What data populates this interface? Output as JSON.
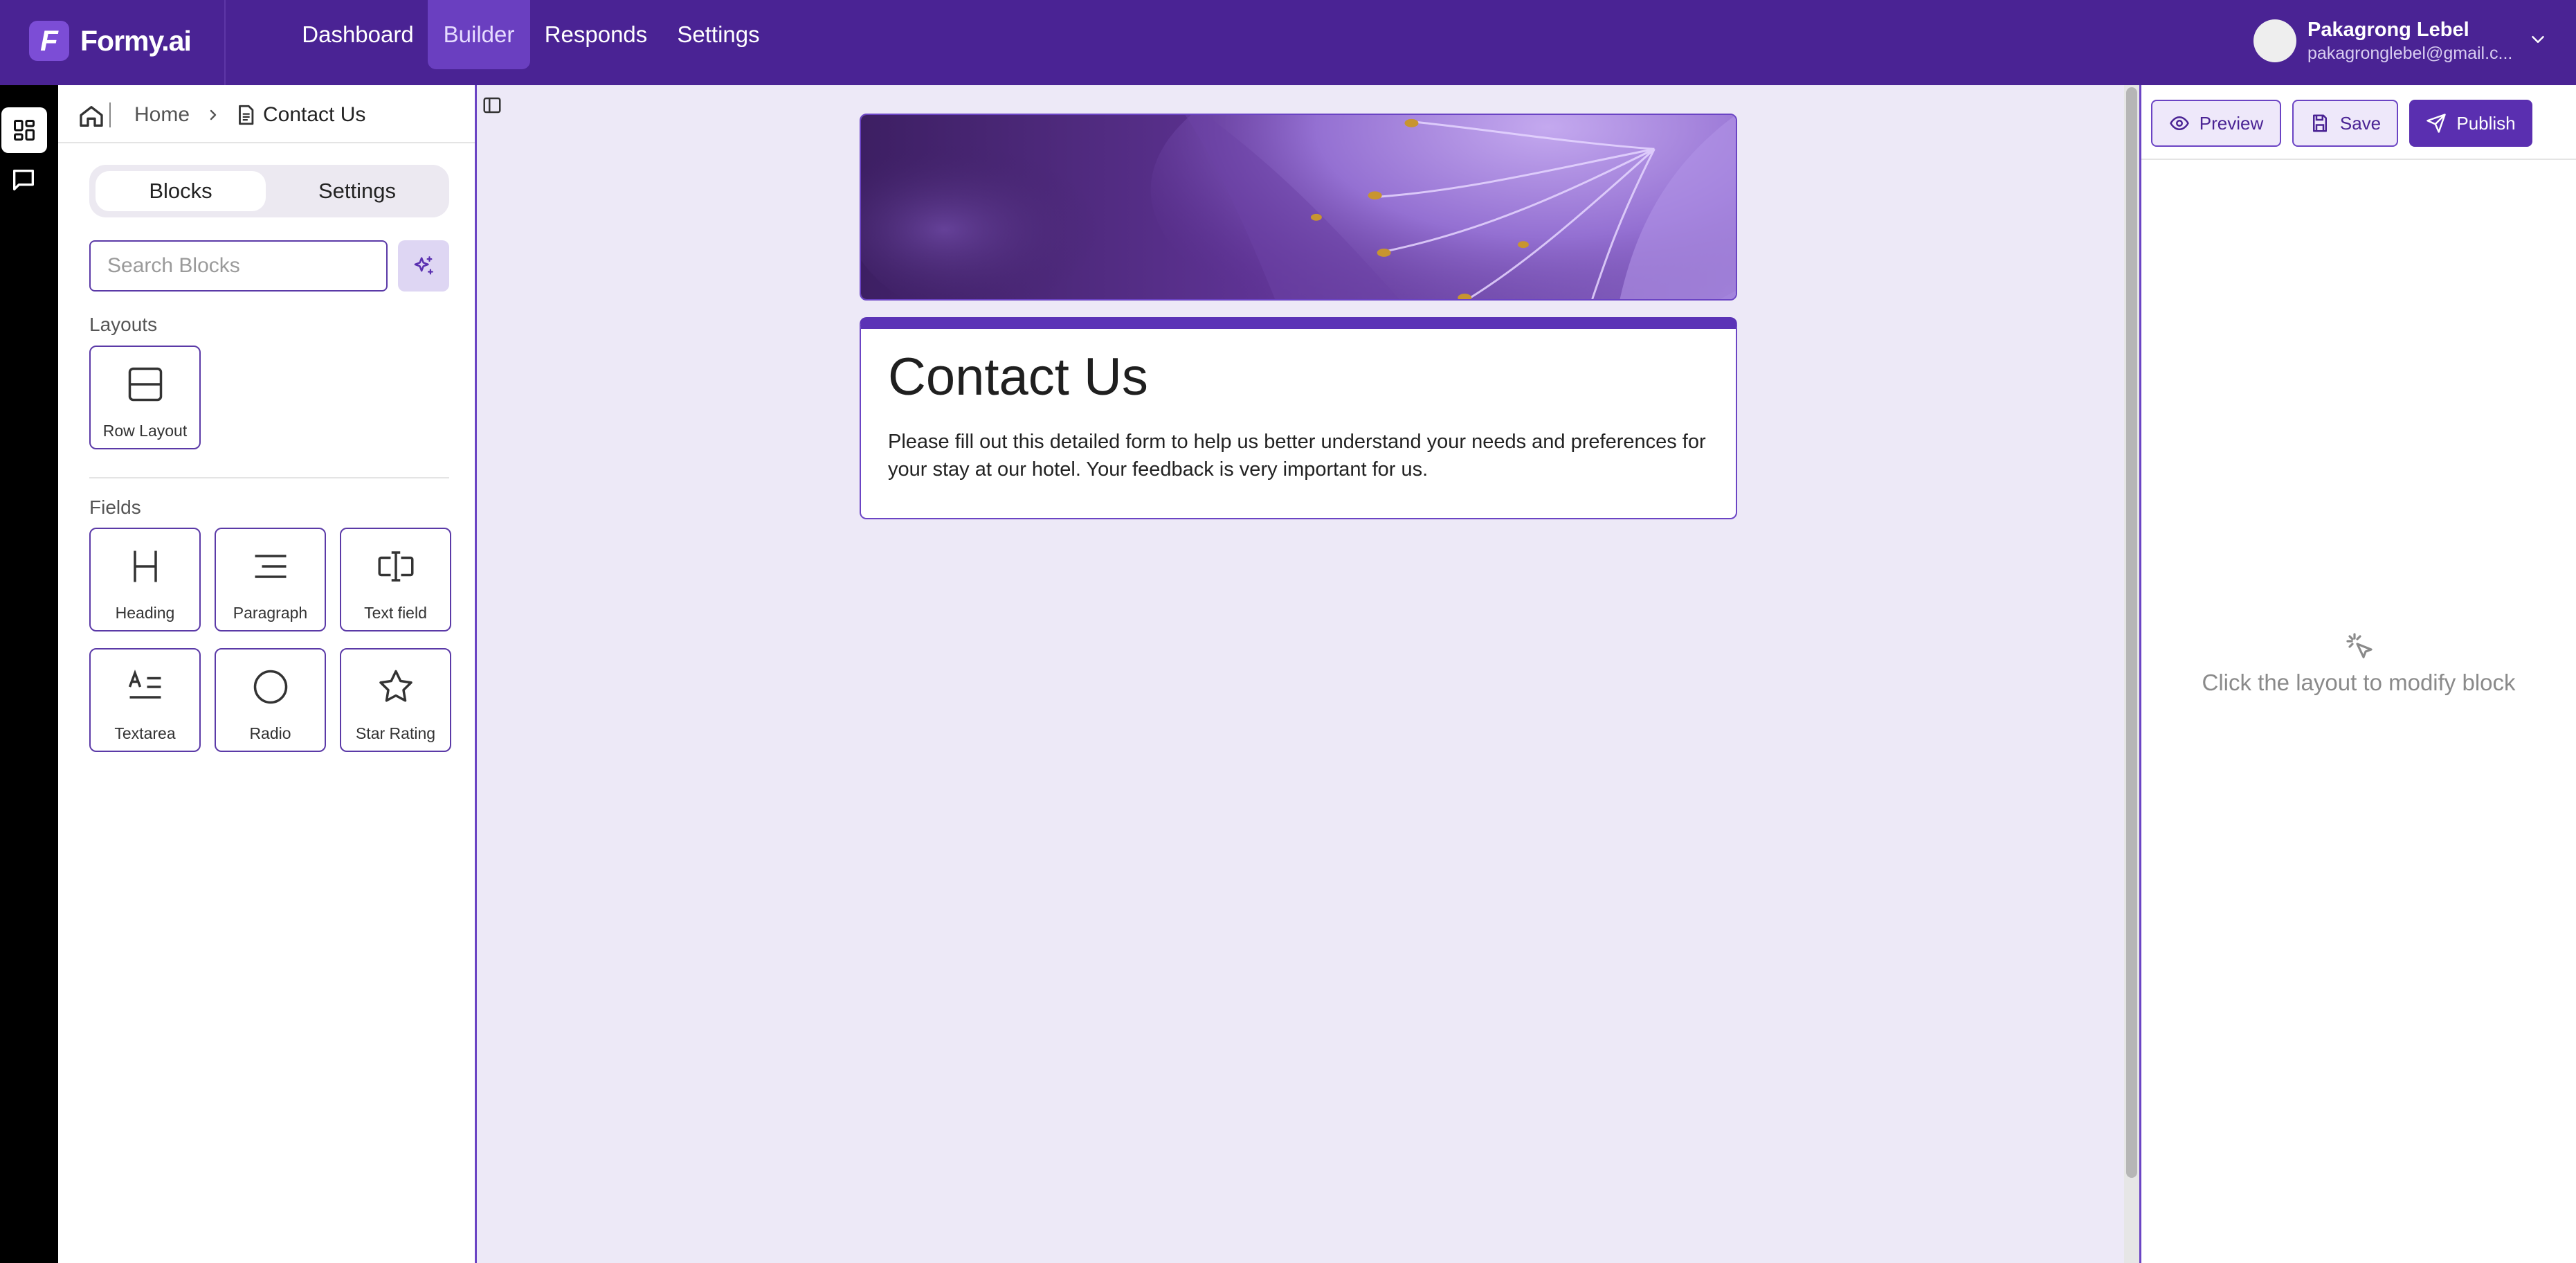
{
  "app": {
    "logo_letter": "F",
    "name": "Formy.ai"
  },
  "nav": [
    {
      "label": "Dashboard",
      "active": false
    },
    {
      "label": "Builder",
      "active": true
    },
    {
      "label": "Responds",
      "active": false
    },
    {
      "label": "Settings",
      "active": false
    }
  ],
  "user": {
    "name": "Pakagrong Lebel",
    "email": "pakagronglebel@gmail.c..."
  },
  "breadcrumb": {
    "home": "Home",
    "current": "Contact Us"
  },
  "panel": {
    "tabs": [
      {
        "label": "Blocks",
        "active": true
      },
      {
        "label": "Settings",
        "active": false
      }
    ],
    "search_placeholder": "Search Blocks",
    "layouts_title": "Layouts",
    "layouts": [
      {
        "label": "Row Layout",
        "icon": "row-layout-icon"
      }
    ],
    "fields_title": "Fields",
    "fields": [
      {
        "label": "Heading",
        "icon": "heading-icon"
      },
      {
        "label": "Paragraph",
        "icon": "paragraph-icon"
      },
      {
        "label": "Text field",
        "icon": "text-field-icon"
      },
      {
        "label": "Textarea",
        "icon": "textarea-icon"
      },
      {
        "label": "Radio",
        "icon": "radio-icon"
      },
      {
        "label": "Star Rating",
        "icon": "star-icon"
      }
    ]
  },
  "form": {
    "title": "Contact Us",
    "description": "Please fill out this detailed form to help us better understand your needs and preferences for your stay at our hotel. Your feedback is very important for us."
  },
  "actions": {
    "preview": "Preview",
    "save": "Save",
    "publish": "Publish"
  },
  "inspector": {
    "empty_hint": "Click the layout to modify block"
  },
  "colors": {
    "brand": "#4a2394",
    "accent": "#6b44c4",
    "canvas": "#ede9f7"
  }
}
